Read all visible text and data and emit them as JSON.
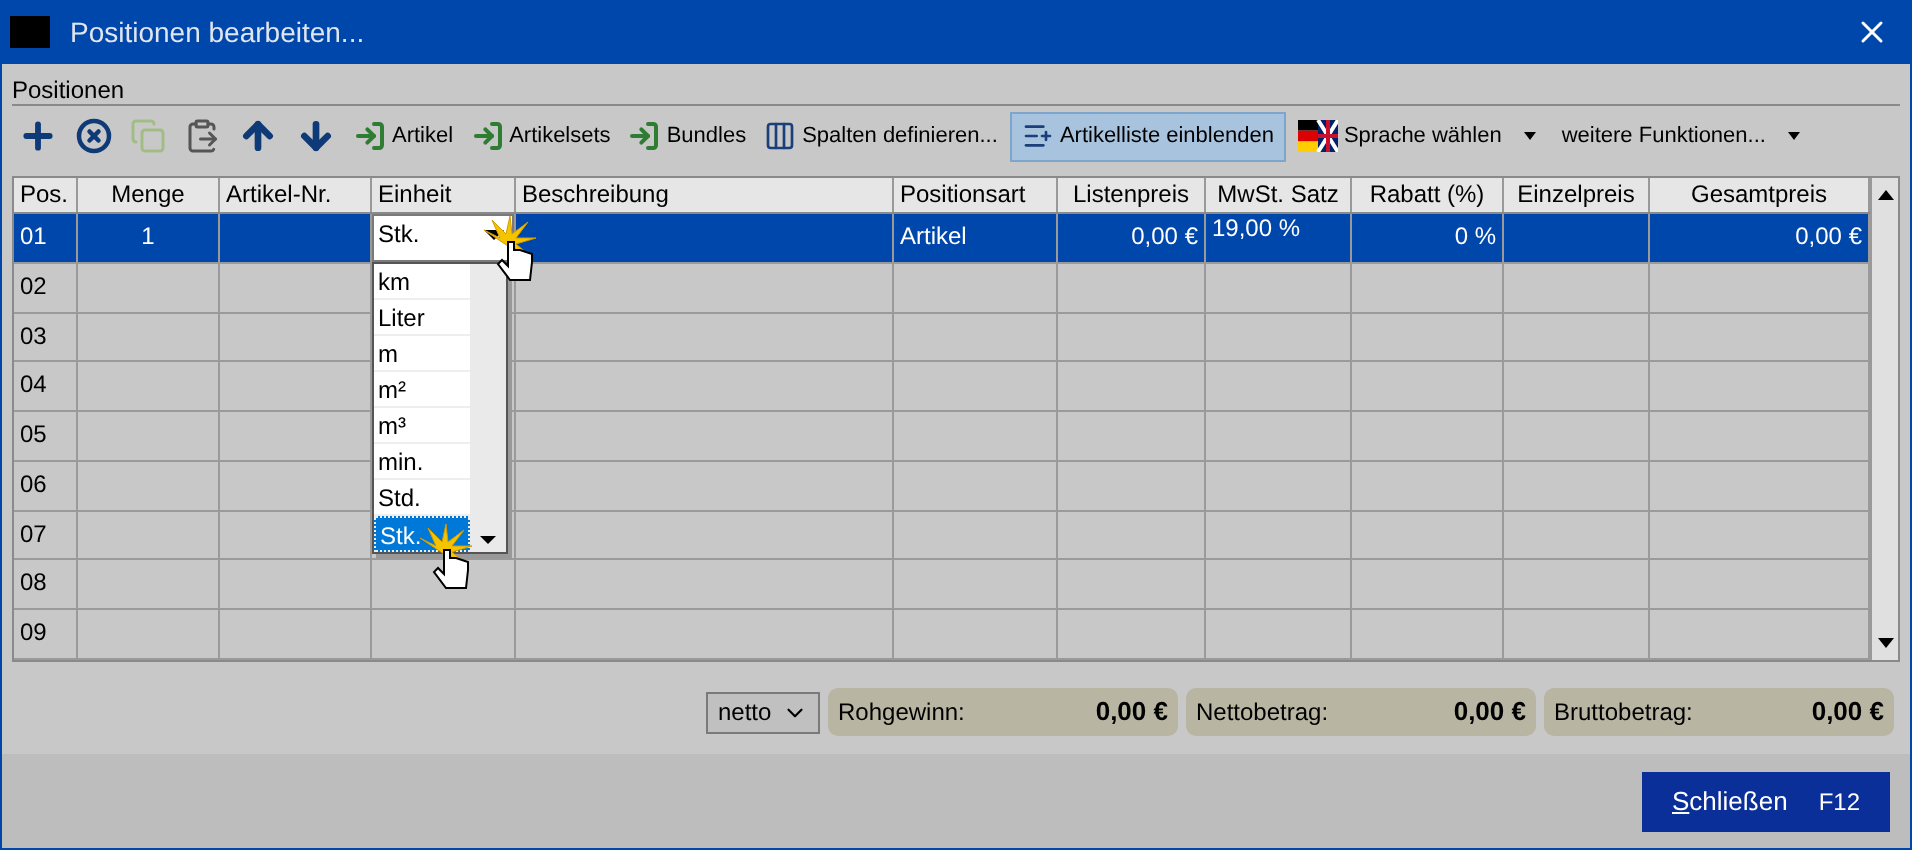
{
  "window": {
    "title": "Positionen bearbeiten..."
  },
  "section_label": "Positionen",
  "toolbar": [
    {
      "kind": "add",
      "disabled": false,
      "selected": false
    },
    {
      "kind": "delete",
      "disabled": false,
      "selected": false
    },
    {
      "kind": "copy",
      "disabled": true,
      "selected": false
    },
    {
      "kind": "paste",
      "disabled": false,
      "selected": false
    },
    {
      "kind": "up",
      "disabled": false,
      "selected": false
    },
    {
      "kind": "down",
      "disabled": false,
      "selected": false
    },
    {
      "kind": "insert",
      "label": "Artikel",
      "disabled": false,
      "selected": false
    },
    {
      "kind": "insert",
      "label": "Artikelsets",
      "disabled": false,
      "selected": false
    },
    {
      "kind": "insert",
      "label": "Bundles",
      "disabled": false,
      "selected": false
    },
    {
      "kind": "columns",
      "label": "Spalten definieren...",
      "disabled": false,
      "selected": false
    },
    {
      "kind": "list",
      "label": "Artikelliste einblenden",
      "disabled": false,
      "selected": true
    },
    {
      "kind": "language",
      "label": "Sprache wählen",
      "disabled": false,
      "selected": false
    },
    {
      "kind": "menu",
      "label": "weitere Funktionen...",
      "disabled": false,
      "selected": false
    }
  ],
  "table": {
    "columns": [
      "Pos.",
      "Menge",
      "Artikel-Nr.",
      "Einheit",
      "Beschreibung",
      "Positionsart",
      "Listenpreis",
      "MwSt. Satz",
      "Rabatt (%)",
      "Einzelpreis",
      "Gesamtpreis"
    ],
    "rows": [
      {
        "selected": true,
        "cells": [
          "01",
          "1",
          "",
          "Stk.",
          "",
          "Artikel",
          "0,00 €",
          "19,00 %",
          "0 %",
          "",
          "0,00 €"
        ]
      },
      {
        "selected": false,
        "cells": [
          "02",
          "",
          "",
          "",
          "",
          "",
          "",
          "",
          "",
          "",
          ""
        ]
      },
      {
        "selected": false,
        "cells": [
          "03",
          "",
          "",
          "",
          "",
          "",
          "",
          "",
          "",
          "",
          ""
        ]
      },
      {
        "selected": false,
        "cells": [
          "04",
          "",
          "",
          "",
          "",
          "",
          "",
          "",
          "",
          "",
          ""
        ]
      },
      {
        "selected": false,
        "cells": [
          "05",
          "",
          "",
          "",
          "",
          "",
          "",
          "",
          "",
          "",
          ""
        ]
      },
      {
        "selected": false,
        "cells": [
          "06",
          "",
          "",
          "",
          "",
          "",
          "",
          "",
          "",
          "",
          ""
        ]
      },
      {
        "selected": false,
        "cells": [
          "07",
          "",
          "",
          "",
          "",
          "",
          "",
          "",
          "",
          "",
          ""
        ]
      },
      {
        "selected": false,
        "cells": [
          "08",
          "",
          "",
          "",
          "",
          "",
          "",
          "",
          "",
          "",
          ""
        ]
      },
      {
        "selected": false,
        "cells": [
          "09",
          "",
          "",
          "",
          "",
          "",
          "",
          "",
          "",
          "",
          ""
        ]
      }
    ]
  },
  "unit_dropdown": {
    "options": [
      {
        "label": "km",
        "selected": false
      },
      {
        "label": "Liter",
        "selected": false
      },
      {
        "label": "m",
        "selected": false
      },
      {
        "label": "m²",
        "selected": false
      },
      {
        "label": "m³",
        "selected": false
      },
      {
        "label": "min.",
        "selected": false
      },
      {
        "label": "Std.",
        "selected": false
      },
      {
        "label": "Stk.",
        "selected": true
      }
    ]
  },
  "footer": {
    "mode": "netto",
    "totals": [
      {
        "label": "Rohgewinn:",
        "value": "0,00 €"
      },
      {
        "label": "Nettobetrag:",
        "value": "0,00 €"
      },
      {
        "label": "Bruttobetrag:",
        "value": "0,00 €"
      }
    ]
  },
  "close_button": {
    "label": "Schließen",
    "shortcut": "F12"
  }
}
